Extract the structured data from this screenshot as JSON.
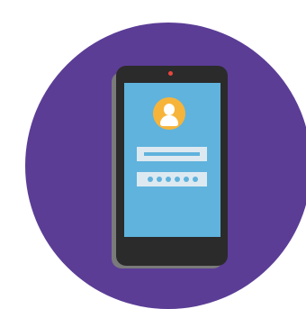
{
  "illustration": {
    "subject": "",
    "colors": {
      "background_circle": "#5b3d96",
      "phone_body": "#2b2b2b",
      "phone_shadow": "#7a7a7a",
      "screen": "#5fb3dd",
      "avatar": "#f6b43b",
      "field": "#dde9f1",
      "camera": "#e8463c"
    },
    "icons": [
      "user-avatar-icon"
    ],
    "password_mask_count": 6
  }
}
